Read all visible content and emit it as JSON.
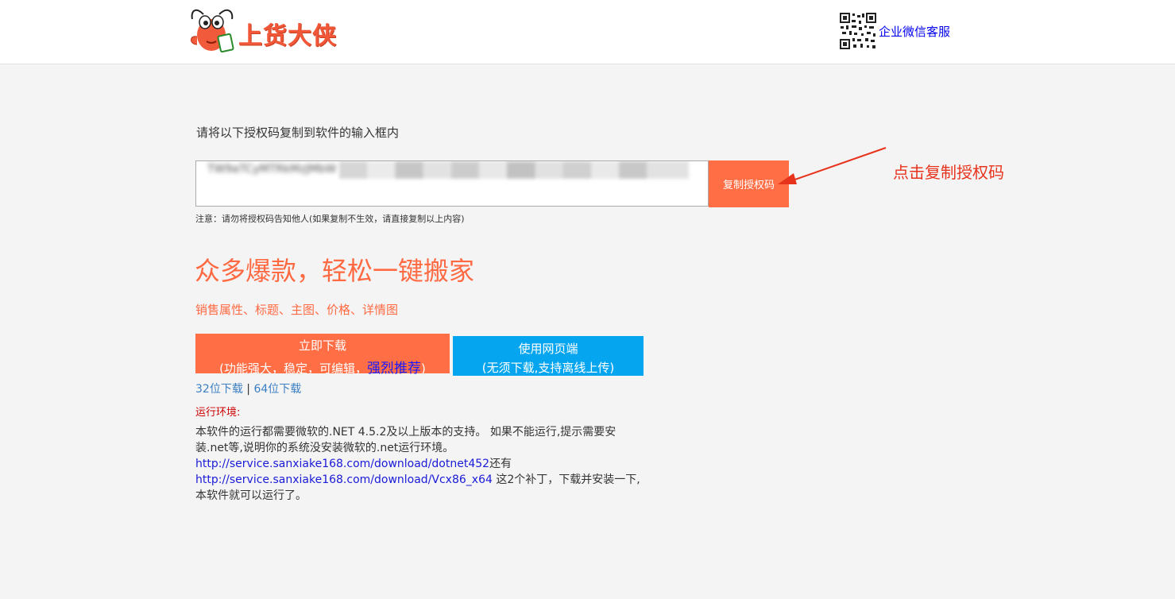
{
  "header": {
    "logo_text": "上货大侠",
    "service_link": "企业微信客服"
  },
  "auth": {
    "instruction": "请将以下授权码复制到软件的输入框内",
    "code_value": "TW9aTCyMTRkMzJMbW",
    "copy_button": "复制授权码",
    "annotation": "点击复制授权码",
    "notice": "注意：请勿将授权码告知他人(如果复制不生效，请直接复制以上内容)"
  },
  "promo": {
    "headline": "众多爆款，轻松一键搬家",
    "subline": "销售属性、标题、主图、价格、详情图"
  },
  "download": {
    "line1": "立即下载",
    "line2_prefix": "(功能强大，稳定，可编辑，",
    "line2_highlight": "强烈推荐",
    "line2_suffix": ")",
    "link32": "32位下载",
    "separator": " | ",
    "link64": "64位下载"
  },
  "web": {
    "line1": "使用网页端",
    "line2": "(无须下载,支持离线上传)"
  },
  "env": {
    "label": "运行环境:",
    "text1": "本软件的运行都需要微软的.NET 4.5.2及以上版本的支持。 如果不能运行,提示需要安装.net等,说明你的系统没安装微软的.net运行环境。",
    "link1": "http://service.sanxiake168.com/download/dotnet452",
    "text2": "还有",
    "link2": "http://service.sanxiake168.com/download/Vcx86_x64",
    "text3": " 这2个补丁，下载并安装一下,本软件就可以运行了。"
  },
  "colors": {
    "brand_orange": "#ff6e44",
    "web_blue": "#05a6ef",
    "annotation_red": "#e8331c"
  },
  "icons": {
    "logo": "crawfish-mascot-icon",
    "qr": "qr-code-icon",
    "arrow": "red-arrow-annotation"
  }
}
